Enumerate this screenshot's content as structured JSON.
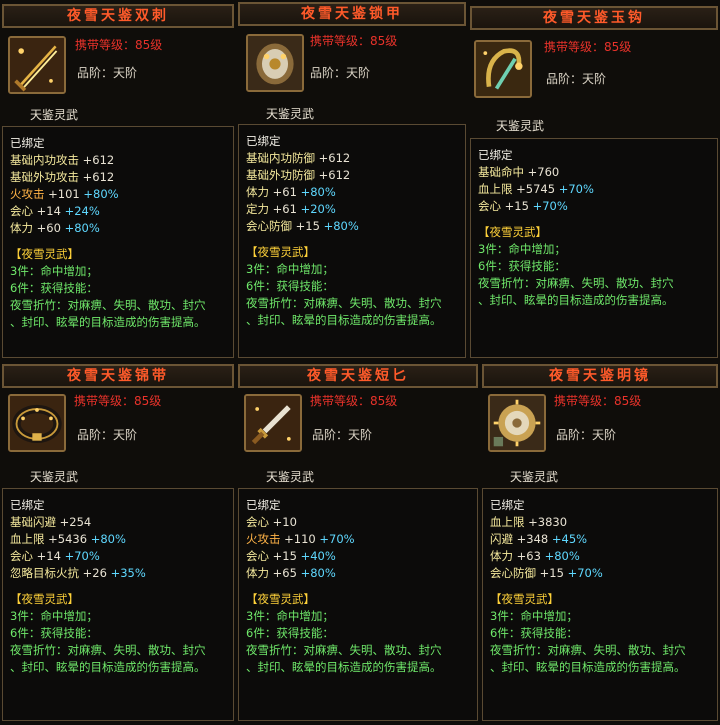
{
  "cards": [
    {
      "title": "夜雪天鉴双刺",
      "icon": "twin-blade-icon",
      "req": "携带等级：85级",
      "grade": "品阶：天阶",
      "subtitle": "天鉴灵武",
      "bound": "已绑定",
      "stats": [
        {
          "name": "基础内功攻击",
          "val": "+612",
          "pct": ""
        },
        {
          "name": "基础外功攻击",
          "val": "+612",
          "pct": ""
        },
        {
          "name": "火攻击",
          "val": "+101",
          "pct": "+80%"
        },
        {
          "name": "会心",
          "val": "+14",
          "pct": "+24%"
        },
        {
          "name": "体力",
          "val": "+60",
          "pct": "+80%"
        }
      ],
      "set_title": "【夜雪灵武】",
      "set_lines": [
        "3件：命中增加；",
        "6件：获得技能：",
        "夜雪折竹：对麻痹、失明、散功、封穴",
        "、封印、眩晕的目标造成的伤害提高。"
      ]
    },
    {
      "title": "夜雪天鉴锁甲",
      "icon": "armor-icon",
      "req": "携带等级：85级",
      "grade": "品阶：天阶",
      "subtitle": "天鉴灵武",
      "bound": "已绑定",
      "stats": [
        {
          "name": "基础内功防御",
          "val": "+612",
          "pct": ""
        },
        {
          "name": "基础外功防御",
          "val": "+612",
          "pct": ""
        },
        {
          "name": "体力",
          "val": "+61",
          "pct": "+80%"
        },
        {
          "name": "定力",
          "val": "+61",
          "pct": "+20%"
        },
        {
          "name": "会心防御",
          "val": "+15",
          "pct": "+80%"
        }
      ],
      "set_title": "【夜雪灵武】",
      "set_lines": [
        "3件：命中增加；",
        "6件：获得技能：",
        "夜雪折竹：对麻痹、失明、散功、封穴",
        "、封印、眩晕的目标造成的伤害提高。"
      ]
    },
    {
      "title": "夜雪天鉴玉钩",
      "icon": "jade-hook-icon",
      "req": "携带等级：85级",
      "grade": "品阶：天阶",
      "subtitle": "天鉴灵武",
      "bound": "已绑定",
      "stats": [
        {
          "name": "基础命中",
          "val": "+760",
          "pct": ""
        },
        {
          "name": "血上限",
          "val": "+5745",
          "pct": "+70%"
        },
        {
          "name": "会心",
          "val": "+15",
          "pct": "+70%"
        }
      ],
      "set_title": "【夜雪灵武】",
      "set_lines": [
        "3件：命中增加；",
        "6件：获得技能：",
        "夜雪折竹：对麻痹、失明、散功、封穴",
        "、封印、眩晕的目标造成的伤害提高。"
      ]
    },
    {
      "title": "夜雪天鉴锦带",
      "icon": "belt-icon",
      "req": "携带等级：85级",
      "grade": "品阶：天阶",
      "subtitle": "天鉴灵武",
      "bound": "已绑定",
      "stats": [
        {
          "name": "基础闪避",
          "val": "+254",
          "pct": ""
        },
        {
          "name": "血上限",
          "val": "+5436",
          "pct": "+80%"
        },
        {
          "name": "会心",
          "val": "+14",
          "pct": "+70%"
        },
        {
          "name": "忽略目标火抗",
          "val": "+26",
          "pct": "+35%"
        }
      ],
      "set_title": "【夜雪灵武】",
      "set_lines": [
        "3件：命中增加；",
        "6件：获得技能：",
        "夜雪折竹：对麻痹、失明、散功、封穴",
        "、封印、眩晕的目标造成的伤害提高。"
      ]
    },
    {
      "title": "夜雪天鉴短匕",
      "icon": "dagger-icon",
      "req": "携带等级：85级",
      "grade": "品阶：天阶",
      "subtitle": "天鉴灵武",
      "bound": "已绑定",
      "stats": [
        {
          "name": "会心",
          "val": "+10",
          "pct": ""
        },
        {
          "name": "火攻击",
          "val": "+110",
          "pct": "+70%"
        },
        {
          "name": "会心",
          "val": "+15",
          "pct": "+40%"
        },
        {
          "name": "体力",
          "val": "+65",
          "pct": "+80%"
        }
      ],
      "set_title": "【夜雪灵武】",
      "set_lines": [
        "3件：命中增加；",
        "6件：获得技能：",
        "夜雪折竹：对麻痹、失明、散功、封穴",
        "、封印、眩晕的目标造成的伤害提高。"
      ]
    },
    {
      "title": "夜雪天鉴明镜",
      "icon": "mirror-icon",
      "req": "携带等级：85级",
      "grade": "品阶：天阶",
      "subtitle": "天鉴灵武",
      "bound": "已绑定",
      "stats": [
        {
          "name": "血上限",
          "val": "+3830",
          "pct": ""
        },
        {
          "name": "闪避",
          "val": "+348",
          "pct": "+45%"
        },
        {
          "name": "体力",
          "val": "+63",
          "pct": "+80%"
        },
        {
          "name": "会心防御",
          "val": "+15",
          "pct": "+70%"
        }
      ],
      "set_title": "【夜雪灵武】",
      "set_lines": [
        "3件：命中增加；",
        "6件：获得技能：",
        "夜雪折竹：对麻痹、失明、散功、封穴",
        "、封印、眩晕的目标造成的伤害提高。"
      ]
    }
  ]
}
